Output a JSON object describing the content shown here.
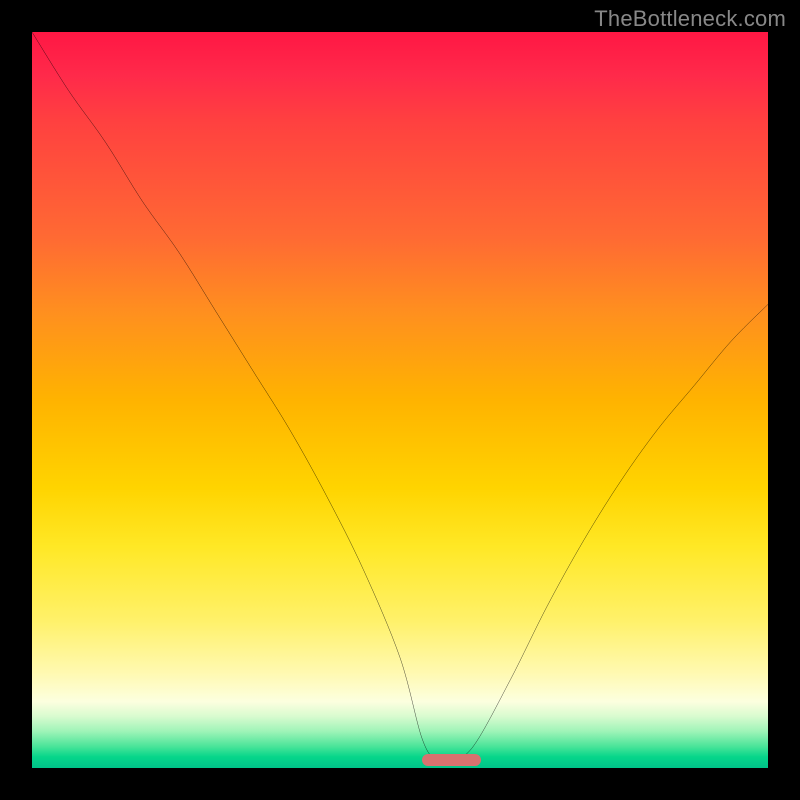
{
  "watermark": "TheBottleneck.com",
  "marker": {
    "left_pct": 53,
    "width_pct": 8
  },
  "colors": {
    "frame": "#000000",
    "marker": "#d7726f",
    "watermark": "#888888",
    "curve": "#000000"
  },
  "chart_data": {
    "type": "line",
    "title": "",
    "xlabel": "",
    "ylabel": "",
    "xlim": [
      0,
      100
    ],
    "ylim": [
      0,
      100
    ],
    "x": [
      0,
      5,
      10,
      15,
      20,
      25,
      30,
      35,
      40,
      45,
      50,
      53,
      55,
      57,
      60,
      65,
      70,
      75,
      80,
      85,
      90,
      95,
      100
    ],
    "values": [
      100,
      92,
      85,
      77,
      70,
      62,
      54,
      46,
      37,
      27,
      15,
      4,
      1,
      1,
      3,
      12,
      22,
      31,
      39,
      46,
      52,
      58,
      63
    ],
    "annotations": []
  }
}
